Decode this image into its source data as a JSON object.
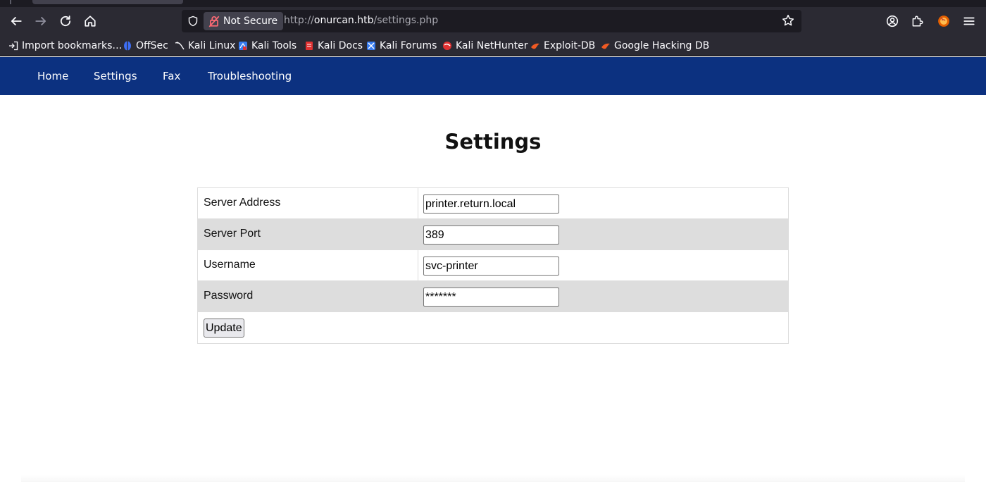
{
  "browser": {
    "security_label": "Not Secure",
    "url": {
      "scheme": "http://",
      "host": "onurcan.htb",
      "path": "/settings.php"
    },
    "icons": [
      "back-icon",
      "forward-icon",
      "reload-icon",
      "home-icon",
      "shield-icon",
      "lock-icon",
      "star-icon",
      "account-icon",
      "extensions-icon",
      "firefox-icon",
      "menu-icon"
    ]
  },
  "bookmarks": [
    {
      "label": "Import bookmarks…",
      "icon": "import-icon"
    },
    {
      "label": "OffSec",
      "icon": "offsec-icon"
    },
    {
      "label": "Kali Linux",
      "icon": "kali-dragon-icon"
    },
    {
      "label": "Kali Tools",
      "icon": "kali-tools-icon"
    },
    {
      "label": "Kali Docs",
      "icon": "kali-docs-icon"
    },
    {
      "label": "Kali Forums",
      "icon": "kali-forums-icon"
    },
    {
      "label": "Kali NetHunter",
      "icon": "nethunter-icon"
    },
    {
      "label": "Exploit-DB",
      "icon": "exploitdb-icon"
    },
    {
      "label": "Google Hacking DB",
      "icon": "ghdb-icon"
    }
  ],
  "site_nav": [
    "Home",
    "Settings",
    "Fax",
    "Troubleshooting"
  ],
  "page": {
    "title": "Settings"
  },
  "form": {
    "rows": [
      {
        "label": "Server Address",
        "value": "printer.return.local"
      },
      {
        "label": "Server Port",
        "value": "389"
      },
      {
        "label": "Username",
        "value": "svc-printer"
      },
      {
        "label": "Password",
        "value": "*******"
      }
    ],
    "submit_label": "Update"
  },
  "colors": {
    "site_nav_bg": "#0c3180",
    "browser_chrome": "#2b2a33",
    "alt_row": "#dddddd"
  }
}
